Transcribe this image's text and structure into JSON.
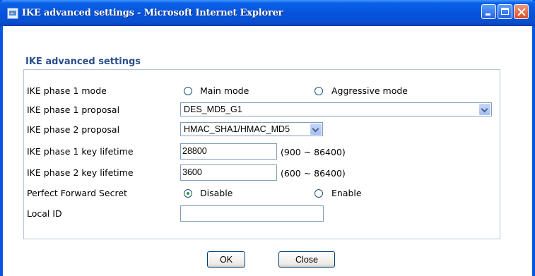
{
  "window": {
    "title": "IKE advanced settings - Microsoft Internet Explorer"
  },
  "section": {
    "heading": "IKE advanced settings"
  },
  "form": {
    "phase1_mode": {
      "label": "IKE phase 1 mode",
      "options": [
        "Main mode",
        "Aggressive mode"
      ],
      "selected": null
    },
    "phase1_proposal": {
      "label": "IKE phase 1 proposal",
      "value": "DES_MD5_G1"
    },
    "phase2_proposal": {
      "label": "IKE phase 2 proposal",
      "value": "HMAC_SHA1/HMAC_MD5"
    },
    "phase1_lifetime": {
      "label": "IKE phase 1 key lifetime",
      "value": "28800",
      "range": "(900 ~ 86400)"
    },
    "phase2_lifetime": {
      "label": "IKE phase 2 key lifetime",
      "value": "3600",
      "range": "(600 ~ 86400)"
    },
    "pfs": {
      "label": "Perfect Forward Secret",
      "options": [
        "Disable",
        "Enable"
      ],
      "selected": "Disable"
    },
    "local_id": {
      "label": "Local ID",
      "value": ""
    }
  },
  "buttons": {
    "ok": "OK",
    "close": "Close"
  },
  "colors": {
    "titlebar": "#0552dc",
    "heading": "#2b4e8c",
    "panel_border": "#b6c4d8"
  }
}
